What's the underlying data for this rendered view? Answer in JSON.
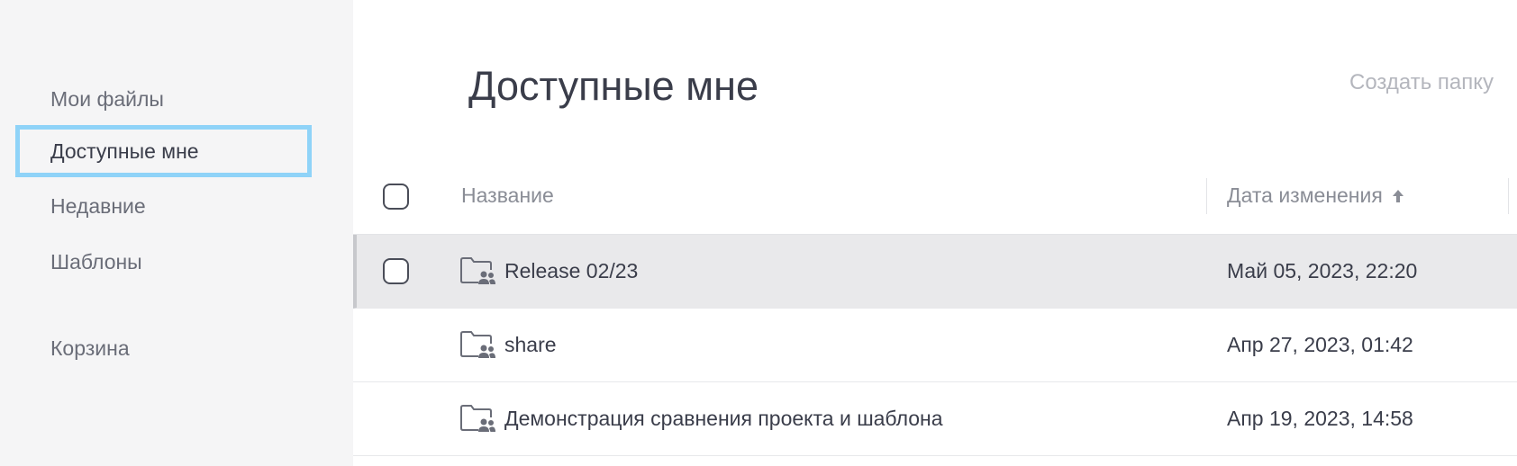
{
  "sidebar": {
    "items": [
      {
        "label": "Мои файлы"
      },
      {
        "label": "Доступные мне"
      },
      {
        "label": "Недавние"
      },
      {
        "label": "Шаблоны"
      },
      {
        "label": "Корзина"
      }
    ],
    "active": "Доступные мне"
  },
  "main": {
    "title": "Доступные мне",
    "create_folder_label": "Создать папку"
  },
  "table": {
    "columns": {
      "name": "Название",
      "date": "Дата изменения"
    },
    "sort": {
      "column": "date",
      "direction": "asc",
      "icon": "arrow-up-icon"
    },
    "rows": [
      {
        "name": "Release 02/23",
        "date": "Май 05, 2023, 22:20",
        "icon": "shared-folder-icon",
        "selected": true
      },
      {
        "name": "share",
        "date": "Апр 27, 2023, 01:42",
        "icon": "shared-folder-icon",
        "selected": false
      },
      {
        "name": "Демонстрация сравнения проекта и шаблона",
        "date": "Апр 19, 2023, 14:58",
        "icon": "shared-folder-icon",
        "selected": false
      }
    ]
  },
  "colors": {
    "sidebar_bg": "#f5f5f6",
    "active_outline": "#8fd3f8",
    "selected_row_bg": "#e9e9eb",
    "text": "#3a3d4a",
    "muted": "#8a8d96"
  }
}
